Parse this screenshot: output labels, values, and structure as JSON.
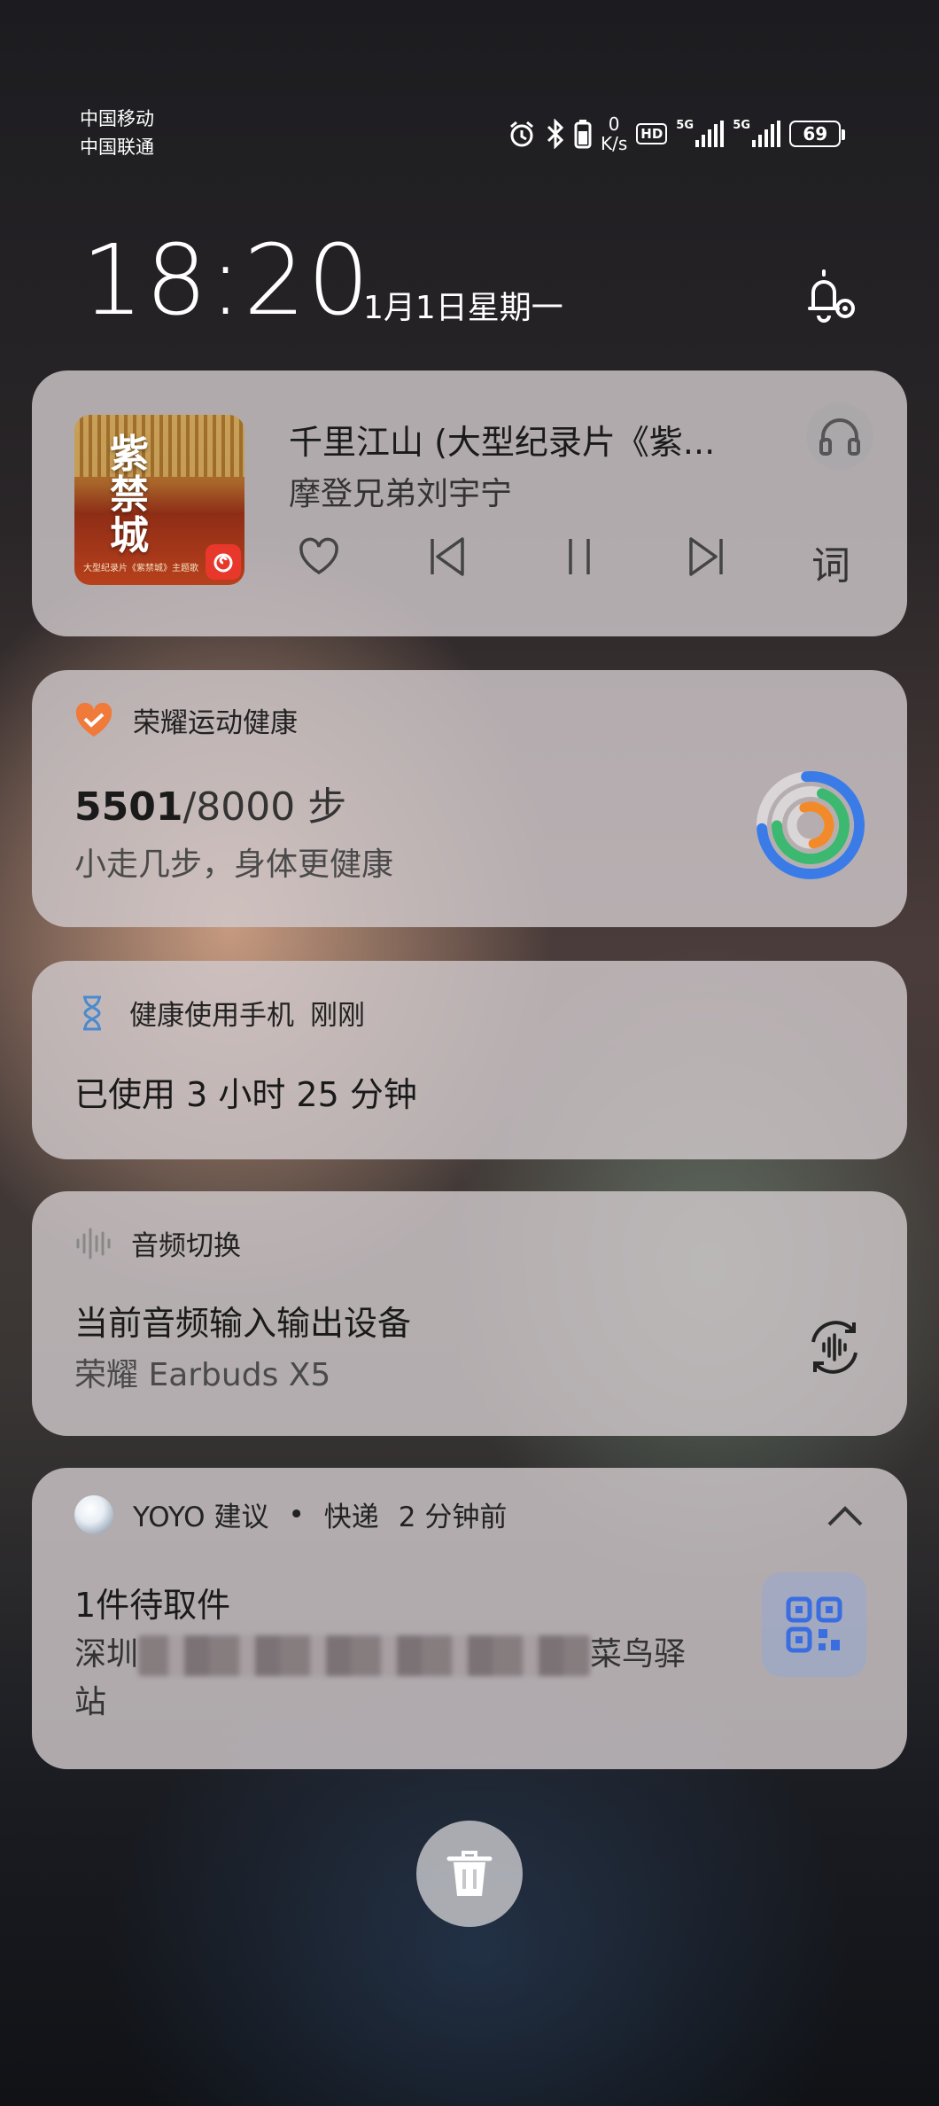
{
  "status_bar": {
    "carrier_1": "中国移动",
    "carrier_2": "中国联通",
    "net_speed_value": "0",
    "net_speed_unit": "K/s",
    "hd_label": "HD",
    "sim1_label": "5G",
    "sim2_label": "5G",
    "battery": "69"
  },
  "lockscreen": {
    "time": "18:20",
    "date": "1月1日星期一"
  },
  "music": {
    "title": "千里江山 (大型纪录片《紫...",
    "artist": "摩登兄弟刘宇宁",
    "album_art_text": "紫禁城",
    "album_caption": "大型纪录片《紫禁城》主题歌",
    "lyrics_label": "词"
  },
  "health": {
    "app_name": "荣耀运动健康",
    "steps_current": "5501",
    "steps_goal": "/8000 步",
    "subtitle": "小走几步，身体更健康"
  },
  "screen_time": {
    "app_name": "健康使用手机",
    "time_ago": "刚刚",
    "usage": "已使用 3 小时 25 分钟"
  },
  "audio_switch": {
    "app_name": "音频切换",
    "title": "当前音频输入输出设备",
    "device": "荣耀 Earbuds X5"
  },
  "yoyo": {
    "app_name": "YOYO 建议",
    "dot": "•",
    "category": "快递",
    "time_ago": "2 分钟前",
    "title": "1件待取件",
    "line1_start": "深圳",
    "line1_end": "菜鸟驿",
    "line2": "站"
  },
  "colors": {
    "card_bg": "#d0c8ca",
    "health_accent": "#f07a3a",
    "ring_blue": "#3a7be8",
    "ring_green": "#3cb870",
    "ring_orange": "#f28a2a",
    "qr_blue": "#3a6ee0"
  }
}
